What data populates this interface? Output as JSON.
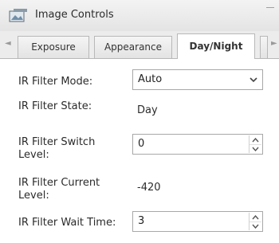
{
  "window": {
    "title": "Image Controls",
    "icon": "image-controls-icon"
  },
  "tabs": [
    {
      "label": "Exposure"
    },
    {
      "label": "Appearance"
    },
    {
      "label": "Day/Night",
      "active": true
    }
  ],
  "form": {
    "ir_filter_mode": {
      "label": "IR Filter Mode:",
      "value": "Auto"
    },
    "ir_filter_state": {
      "label": "IR Filter State:",
      "value": "Day"
    },
    "ir_filter_switch_level": {
      "label": "IR Filter Switch Level:",
      "value": "0"
    },
    "ir_filter_current_level": {
      "label": "IR Filter Current Level:",
      "value": "-420"
    },
    "ir_filter_wait_time": {
      "label": "IR Filter Wait Time:",
      "value": "3"
    }
  }
}
